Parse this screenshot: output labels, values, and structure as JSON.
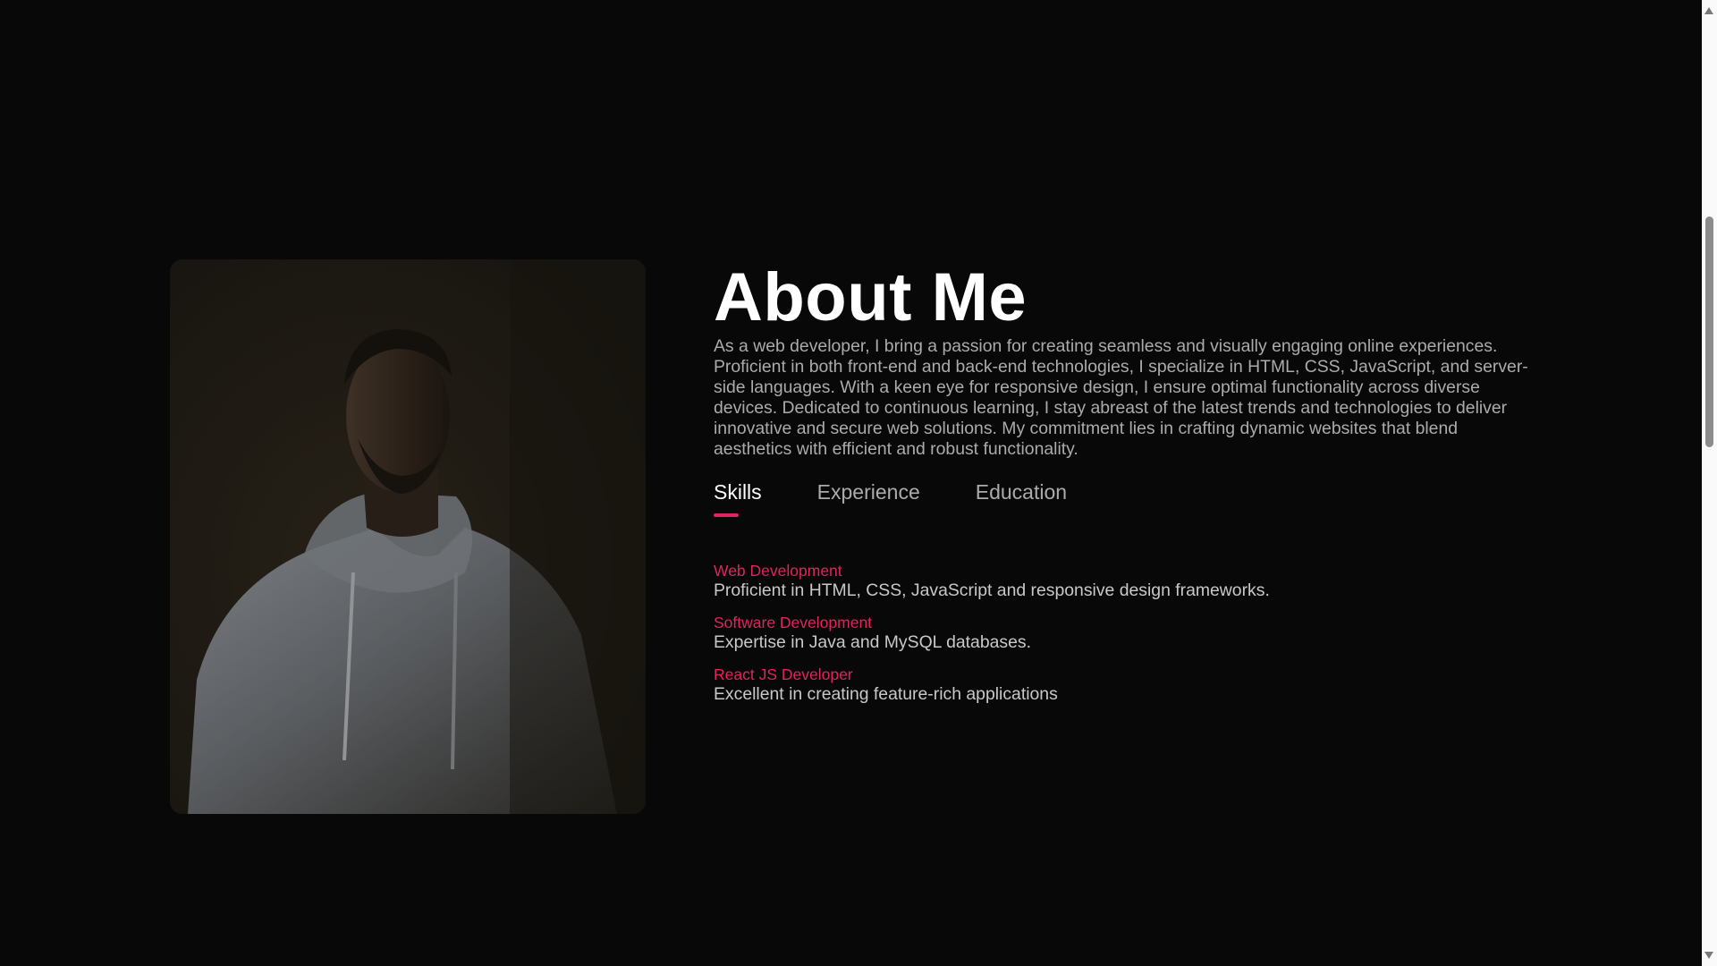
{
  "about": {
    "title": "About Me",
    "bio": "As a web developer, I bring a passion for creating seamless and visually engaging online experiences. Proficient in both front-end and back-end technologies, I specialize in HTML, CSS, JavaScript, and server-side languages. With a keen eye for responsive design, I ensure optimal functionality across diverse devices. Dedicated to continuous learning, I stay abreast of the latest trends and technologies to deliver innovative and secure web solutions. My commitment lies in crafting dynamic websites that blend aesthetics with efficient and robust functionality."
  },
  "tabs": [
    {
      "label": "Skills",
      "active": true
    },
    {
      "label": "Experience",
      "active": false
    },
    {
      "label": "Education",
      "active": false
    }
  ],
  "skills": [
    {
      "title": "Web Development",
      "desc": "Proficient in HTML, CSS, JavaScript and responsive design frameworks."
    },
    {
      "title": "Software Development",
      "desc": "Expertise in Java and MySQL databases."
    },
    {
      "title": "React JS Developer",
      "desc": "Excellent in creating feature-rich applications"
    }
  ],
  "colors": {
    "background": "#080808",
    "accent": "#e0245e",
    "heading": "#ffffff",
    "text": "#ababab"
  }
}
